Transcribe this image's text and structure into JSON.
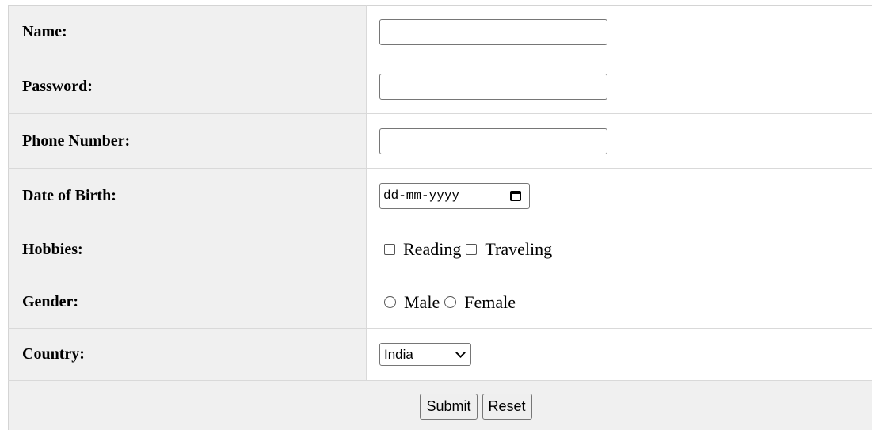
{
  "form": {
    "name": {
      "label": "Name:",
      "value": ""
    },
    "password": {
      "label": "Password:",
      "value": ""
    },
    "phone": {
      "label": "Phone Number:",
      "value": ""
    },
    "dob": {
      "label": "Date of Birth:",
      "placeholder": "dd-mm-yyyy",
      "icon": "calendar-icon"
    },
    "hobbies": {
      "label": "Hobbies:",
      "options": [
        {
          "label": "Reading",
          "checked": false
        },
        {
          "label": "Traveling",
          "checked": false
        }
      ]
    },
    "gender": {
      "label": "Gender:",
      "options": [
        {
          "label": "Male",
          "selected": false
        },
        {
          "label": "Female",
          "selected": false
        }
      ]
    },
    "country": {
      "label": "Country:",
      "selected": "India",
      "icon": "chevron-down-icon"
    },
    "actions": {
      "submit_label": "Submit",
      "reset_label": "Reset"
    }
  },
  "colors": {
    "label_background": "#f0f0f0",
    "field_background": "#ffffff",
    "border": "#d9d9d9"
  }
}
